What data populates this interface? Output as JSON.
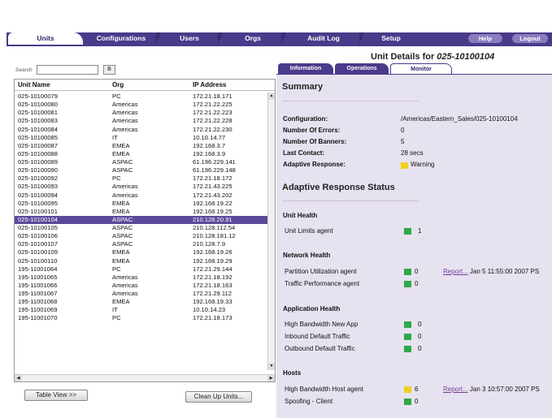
{
  "nav": {
    "tabs": [
      "Units",
      "Configurations",
      "Users",
      "Orgs",
      "Audit Log",
      "Setup"
    ],
    "help": "Help",
    "logout": "Logout"
  },
  "search": {
    "label": "Search",
    "go": "B"
  },
  "list": {
    "headers": {
      "unit": "Unit Name",
      "org": "Org",
      "ip": "IP Address"
    },
    "rows": [
      [
        "025-10100079",
        "PC",
        "172.21.18.171"
      ],
      [
        "025-10100080",
        "Americas",
        "172.21.22.225"
      ],
      [
        "025-10100081",
        "Americas",
        "172.21.22.223"
      ],
      [
        "025-10100083",
        "Americas",
        "172.21.22.228"
      ],
      [
        "025-10100084",
        "Americas",
        "172.21.22.230"
      ],
      [
        "025-10100085",
        "IT",
        "10.10.14.77"
      ],
      [
        "025-10100087",
        "EMEA",
        "192.168.3.7"
      ],
      [
        "025-10100088",
        "EMEA",
        "192.168.3.9"
      ],
      [
        "025-10100089",
        "ASPAC",
        "61.196.229.141"
      ],
      [
        "025-10100090",
        "ASPAC",
        "61.196.229.148"
      ],
      [
        "025-10100092",
        "PC",
        "172.21.18.172"
      ],
      [
        "025-10100093",
        "Americas",
        "172.21.43.225"
      ],
      [
        "025-10100094",
        "Americas",
        "172.21.43.202"
      ],
      [
        "025-10100095",
        "EMEA",
        "192.168.19.22"
      ],
      [
        "025-10100101",
        "EMEA",
        "192.168.19.25"
      ],
      [
        "025-10100104",
        "ASPAC",
        "210.128.20.91"
      ],
      [
        "025-10100105",
        "ASPAC",
        "210.128.112.54"
      ],
      [
        "025-10100106",
        "ASPAC",
        "210.128.181.12"
      ],
      [
        "025-10100107",
        "ASPAC",
        "210.128.7.9"
      ],
      [
        "025-10100109",
        "EMEA",
        "192.168.19.26"
      ],
      [
        "025-10100110",
        "EMEA",
        "192.168.19.29"
      ],
      [
        "195-11001064",
        "PC",
        "172.21.29.144"
      ],
      [
        "195-11001065",
        "Americas",
        "172.21.18.192"
      ],
      [
        "195-11001066",
        "Americas",
        "172.21.18.163"
      ],
      [
        "195-11001067",
        "Americas",
        "172.21.29.112"
      ],
      [
        "195-11001068",
        "EMEA",
        "192.168.19.33"
      ],
      [
        "195-11001069",
        "IT",
        "10.10.14.23"
      ],
      [
        "195-11001070",
        "PC",
        "172.21.18.173"
      ]
    ],
    "selected": "025-10100104"
  },
  "buttons": {
    "table_view": "Table View >>",
    "clean_up": "Clean Up Units..."
  },
  "detail": {
    "title_prefix": "Unit Details for ",
    "unit_id": "025-10100104",
    "tabs": [
      "Information",
      "Operations",
      "Monitor"
    ],
    "active_tab": "Monitor",
    "summary_heading": "Summary",
    "summary": {
      "config_label": "Configuration:",
      "config_value": "/Americas/Eastern_Sales/025-10100104",
      "errors_label": "Number Of Errors:",
      "errors_value": "0",
      "banners_label": "Number Of Banners:",
      "banners_value": "5",
      "contact_label": "Last Contact:",
      "contact_value": "28 secs",
      "adaptive_label": "Adaptive Response:",
      "adaptive_value": "Warning"
    },
    "ars_heading": "Adaptive Response Status",
    "unit_health": {
      "heading": "Unit Health",
      "agent": "Unit Limits agent",
      "value": "1"
    },
    "network_health": {
      "heading": "Network Health",
      "partition": "Partition Utilization agent",
      "partition_value": "0",
      "partition_report": "Report...",
      "partition_time": "Jan 5 11:55:00 2007 PS",
      "traffic": "Traffic Performance agent",
      "traffic_value": "0"
    },
    "app_health": {
      "heading": "Application Health",
      "a1": "High Bandwidth New App",
      "a1v": "0",
      "a2": "Inbound Default Traffic",
      "a2v": "0",
      "a3": "Outbound Default Traffic",
      "a3v": "0"
    },
    "hosts": {
      "heading": "Hosts",
      "h1": "High Bandwidth Host agent",
      "h1v": "6",
      "h1_report": "Report...",
      "h1_time": "Jan 3 10:57:00 2007 PS",
      "h2": "Spoofing - Client",
      "h2v": "0"
    }
  },
  "colors": {
    "nav": "#4a3a8a",
    "selected_row": "#5b4a9b",
    "panel": "#e7e2ef",
    "ok": "#2fa84a",
    "warn": "#f0d020"
  }
}
